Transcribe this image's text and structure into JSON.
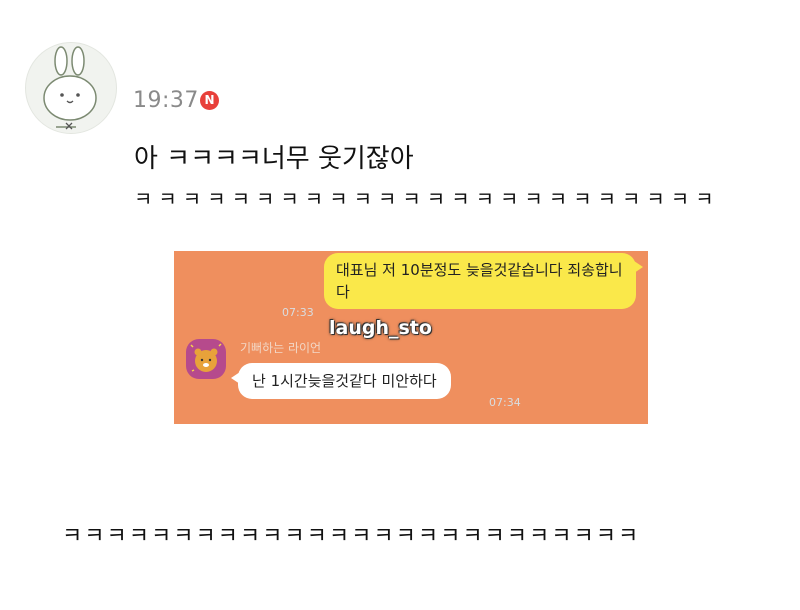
{
  "post": {
    "avatar_icon": "bunny-avatar-icon",
    "time": "19:37",
    "new_badge": "N",
    "line1": "아 ㅋㅋㅋㅋ너무 웃기잖아",
    "line2": "ㅋㅋㅋㅋㅋㅋㅋㅋㅋㅋㅋㅋㅋㅋㅋㅋㅋㅋㅋㅋㅋㅋㅋㅋ"
  },
  "chat_screenshot": {
    "background": "#ef8f5e",
    "my_message": "대표님 저 10분정도 늦을것같습니다 죄송합니다",
    "my_time": "07:33",
    "watermark": "laugh_sto",
    "sender_name": "기뻐하는 라이언",
    "sender_avatar_icon": "ryan-avatar-icon",
    "reply_message": "난 1시간늦을것같다 미안하다",
    "reply_time": "07:34"
  },
  "footer_text": "ㅋㅋㅋㅋㅋㅋㅋㅋㅋㅋㅋㅋㅋㅋㅋㅋㅋㅋㅋㅋㅋㅋㅋㅋㅋㅋ"
}
